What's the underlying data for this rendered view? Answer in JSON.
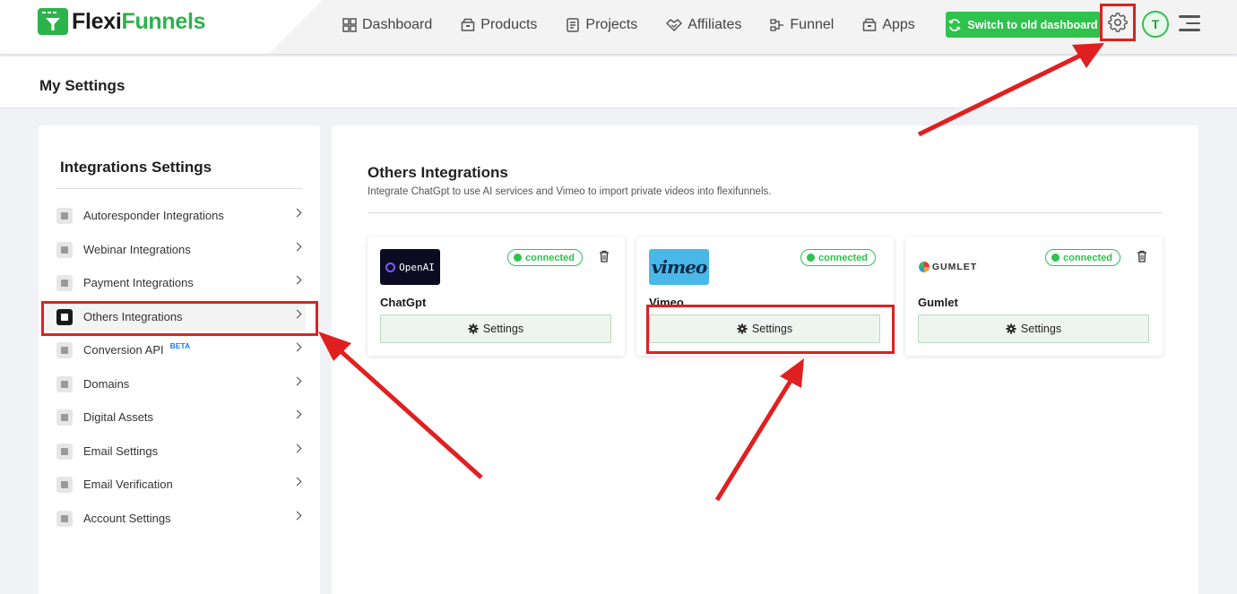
{
  "brand": {
    "name_part1": "Flexi",
    "name_part2": "Funnels"
  },
  "nav": [
    {
      "label": "Dashboard",
      "icon": "grid-icon"
    },
    {
      "label": "Products",
      "icon": "box-icon"
    },
    {
      "label": "Projects",
      "icon": "document-icon"
    },
    {
      "label": "Affiliates",
      "icon": "handshake-icon"
    },
    {
      "label": "Funnel",
      "icon": "funnel-icon"
    },
    {
      "label": "Apps",
      "icon": "apps-icon"
    }
  ],
  "header_actions": {
    "switch_label": "Switch to old dashboard",
    "avatar_initial": "T"
  },
  "page": {
    "title": "My Settings"
  },
  "sidebar": {
    "title": "Integrations Settings",
    "items": [
      {
        "label": "Autoresponder Integrations",
        "icon": "user-icon"
      },
      {
        "label": "Webinar Integrations",
        "icon": "video-icon"
      },
      {
        "label": "Payment Integrations",
        "icon": "dollar-icon"
      },
      {
        "label": "Others Integrations",
        "icon": "file-icon"
      },
      {
        "label": "Conversion API",
        "icon": "document-icon",
        "badge": "BETA"
      },
      {
        "label": "Domains",
        "icon": "globe-icon"
      },
      {
        "label": "Digital Assets",
        "icon": "gift-icon"
      },
      {
        "label": "Email Settings",
        "icon": "email-icon"
      },
      {
        "label": "Email Verification",
        "icon": "email-check-icon"
      },
      {
        "label": "Account Settings",
        "icon": "gear-icon"
      }
    ],
    "active_index": 3
  },
  "main": {
    "title": "Others Integrations",
    "subtitle": "Integrate ChatGpt to use AI services and Vimeo to import private videos into flexifunnels.",
    "cards": [
      {
        "name": "ChatGpt",
        "logo_text": "OpenAI",
        "status": "connected",
        "button": "Settings",
        "deletable": true
      },
      {
        "name": "Vimeo",
        "logo_text": "vimeo",
        "status": "connected",
        "button": "Settings",
        "deletable": false
      },
      {
        "name": "Gumlet",
        "logo_text": "GUMLET",
        "status": "connected",
        "button": "Settings",
        "deletable": true
      }
    ]
  },
  "colors": {
    "brand_green": "#2fc24c",
    "highlight_red": "#e02020",
    "vimeo_blue": "#49b8e8"
  }
}
